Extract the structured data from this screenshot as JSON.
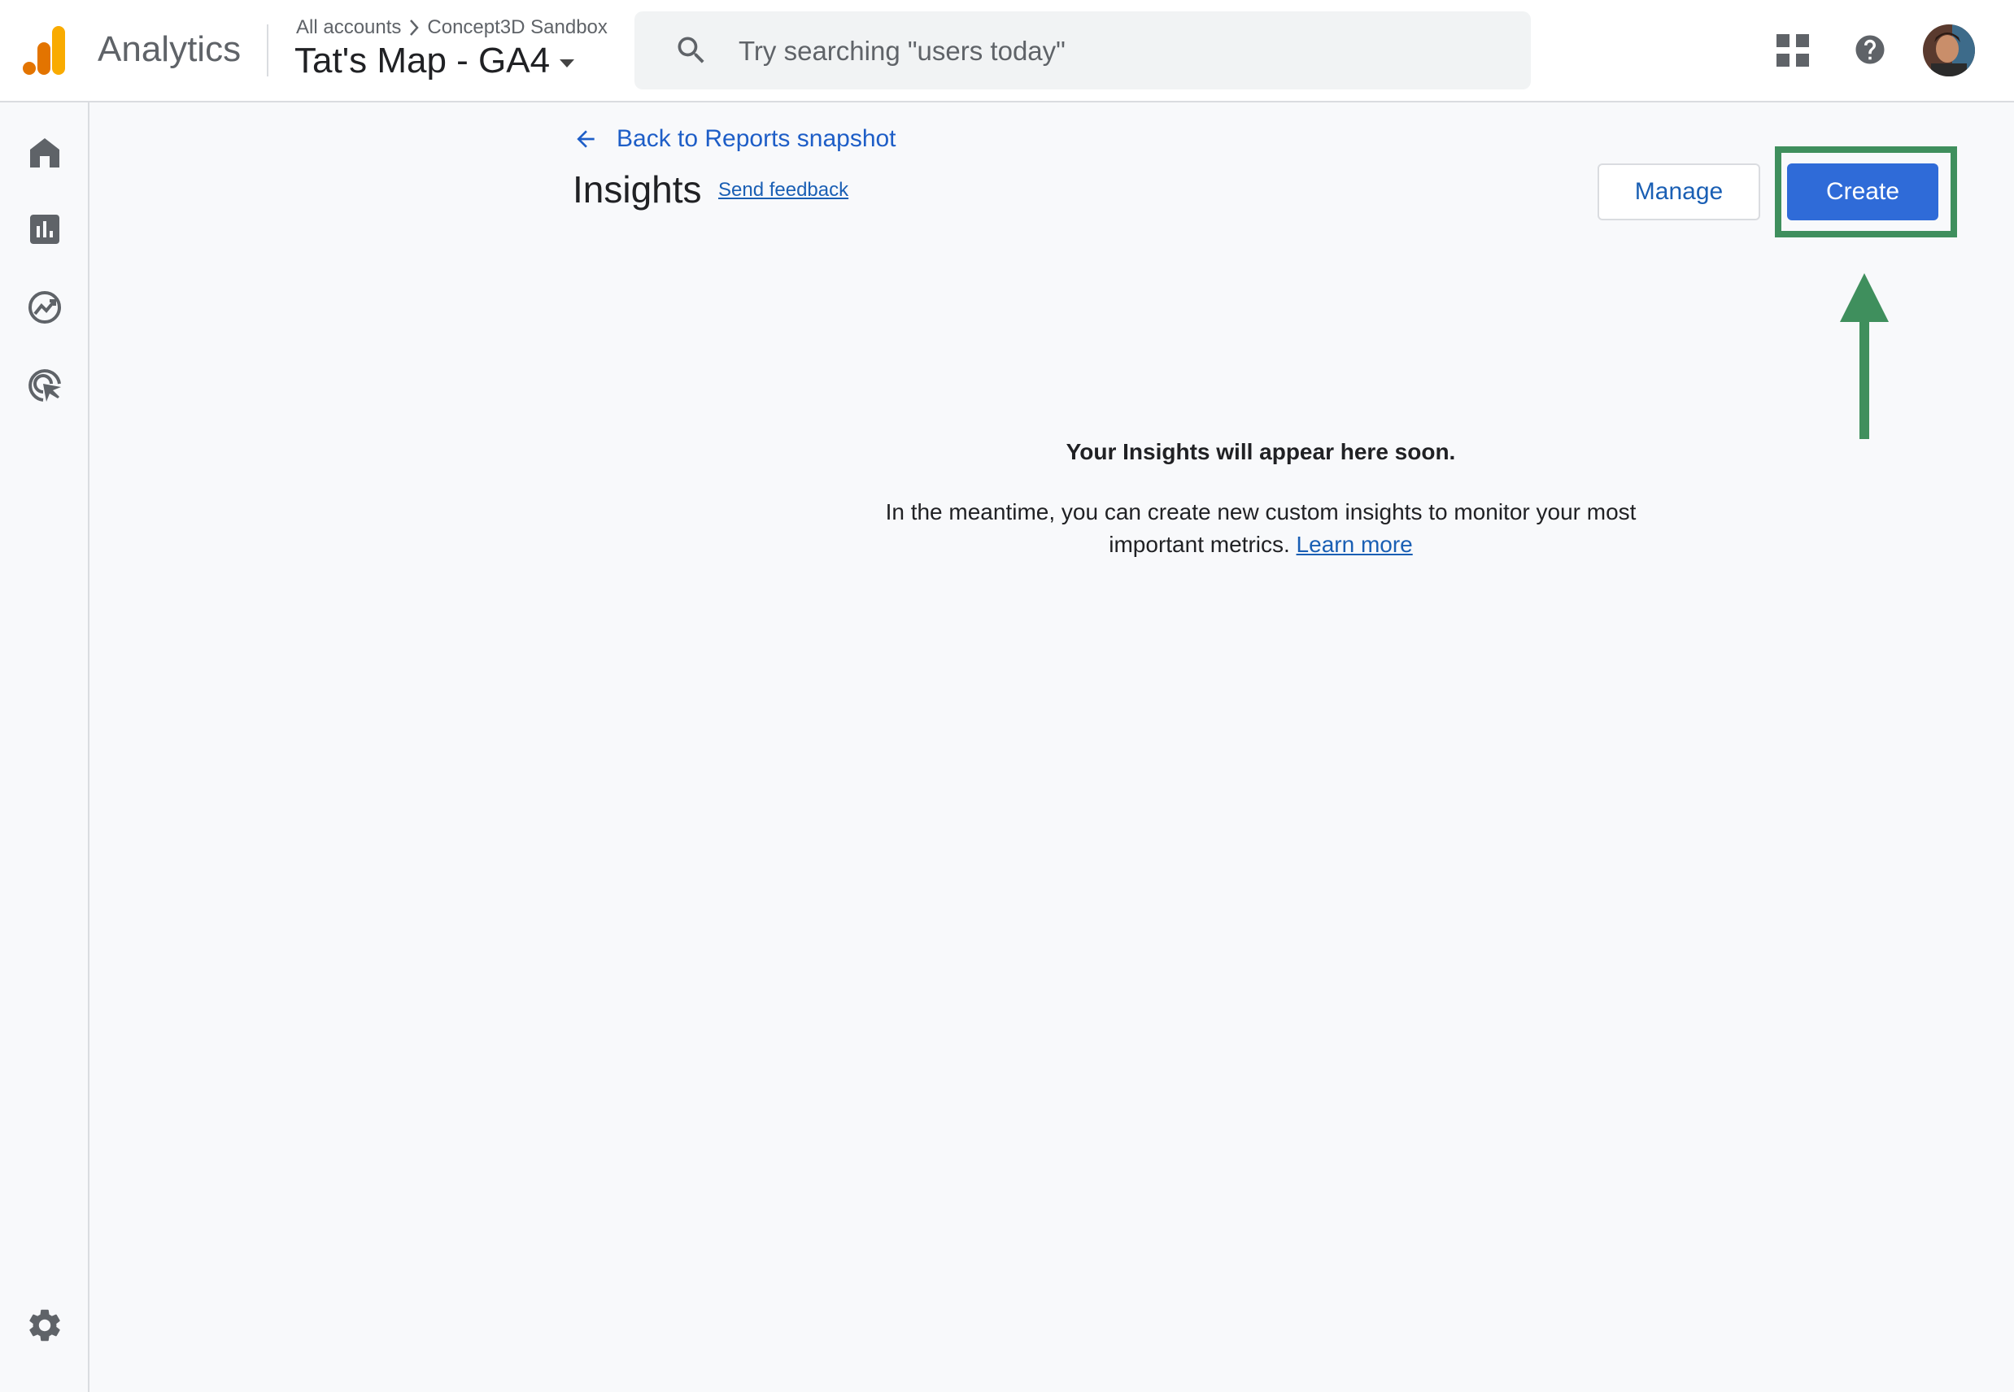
{
  "header": {
    "app_name": "Analytics",
    "breadcrumb": [
      "All accounts",
      "Concept3D Sandbox"
    ],
    "property_name": "Tat's Map - GA4",
    "search_placeholder": "Try searching \"users today\""
  },
  "rail": {
    "items": [
      "home-icon",
      "reports-icon",
      "explore-icon",
      "advertising-icon"
    ],
    "bottom": "admin-gear-icon"
  },
  "main": {
    "back_link": "Back to Reports snapshot",
    "title": "Insights",
    "feedback": "Send feedback",
    "manage_label": "Manage",
    "create_label": "Create",
    "empty_title": "Your Insights will appear here soon.",
    "empty_body": "In the meantime, you can create new custom insights to monitor your most important metrics.",
    "learn_more": "Learn more"
  },
  "colors": {
    "accent": "#1a73e8",
    "create_button": "#2f6bd8",
    "highlight": "#3f8f5d",
    "logo_orange": "#f9ab00",
    "logo_dark_orange": "#e37400"
  }
}
